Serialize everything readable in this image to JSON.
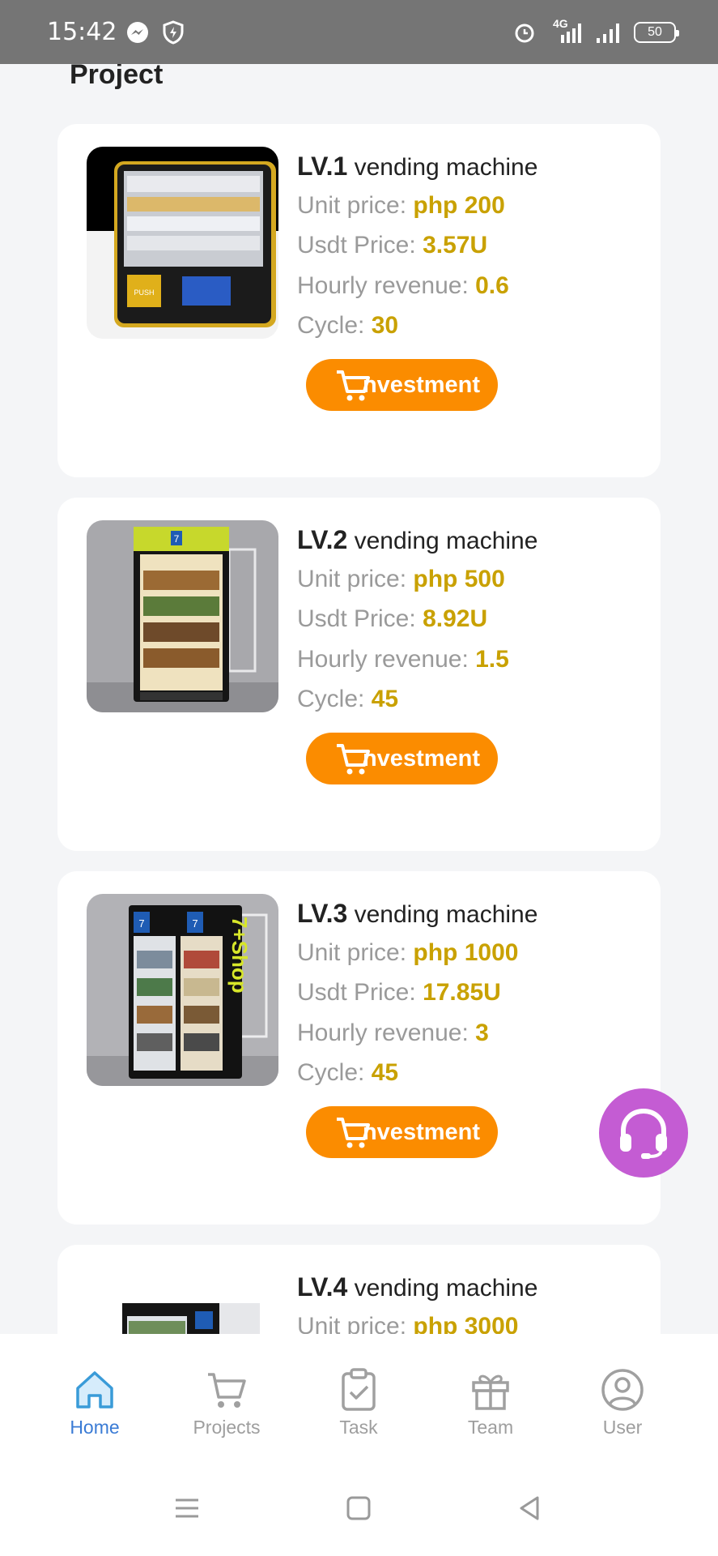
{
  "status_bar": {
    "time": "15:42",
    "network": "4G",
    "battery": "50",
    "icons": [
      "messenger-icon",
      "shield-bolt-icon",
      "alarm-icon",
      "signal-icon",
      "signal-icon",
      "battery-icon"
    ]
  },
  "page": {
    "heading": "Project"
  },
  "projects": [
    {
      "level": "LV.1",
      "name": "vending machine",
      "unit_price_label": "Unit price:",
      "unit_price": "php 200",
      "usdt_label": "Usdt Price:",
      "usdt": "3.57U",
      "hourly_label": "Hourly revenue:",
      "hourly": "0.6",
      "cycle_label": "Cycle:",
      "cycle": "30",
      "button": "nvestment"
    },
    {
      "level": "LV.2",
      "name": "vending machine",
      "unit_price_label": "Unit price:",
      "unit_price": "php 500",
      "usdt_label": "Usdt Price:",
      "usdt": "8.92U",
      "hourly_label": "Hourly revenue:",
      "hourly": "1.5",
      "cycle_label": "Cycle:",
      "cycle": "45",
      "button": "nvestment"
    },
    {
      "level": "LV.3",
      "name": "vending machine",
      "unit_price_label": "Unit price:",
      "unit_price": "php 1000",
      "usdt_label": "Usdt Price:",
      "usdt": "17.85U",
      "hourly_label": "Hourly revenue:",
      "hourly": "3",
      "cycle_label": "Cycle:",
      "cycle": "45",
      "button": "nvestment"
    },
    {
      "level": "LV.4",
      "name": "vending machine",
      "unit_price_label": "Unit price:",
      "unit_price": "php 3000"
    }
  ],
  "machine_texts": {
    "push": "PUSH",
    "brand": "7+Shop",
    "seven": "7"
  },
  "tabs": [
    {
      "label": "Home",
      "icon": "home-icon",
      "active": true
    },
    {
      "label": "Projects",
      "icon": "cart-icon",
      "active": false
    },
    {
      "label": "Task",
      "icon": "clipboard-check-icon",
      "active": false
    },
    {
      "label": "Team",
      "icon": "gift-icon",
      "active": false
    },
    {
      "label": "User",
      "icon": "user-icon",
      "active": false
    }
  ],
  "colors": {
    "accent_value": "#c9a100",
    "button": "#fb8c00",
    "tab_active": "#3a7bd5",
    "support": "#c45cd3"
  }
}
